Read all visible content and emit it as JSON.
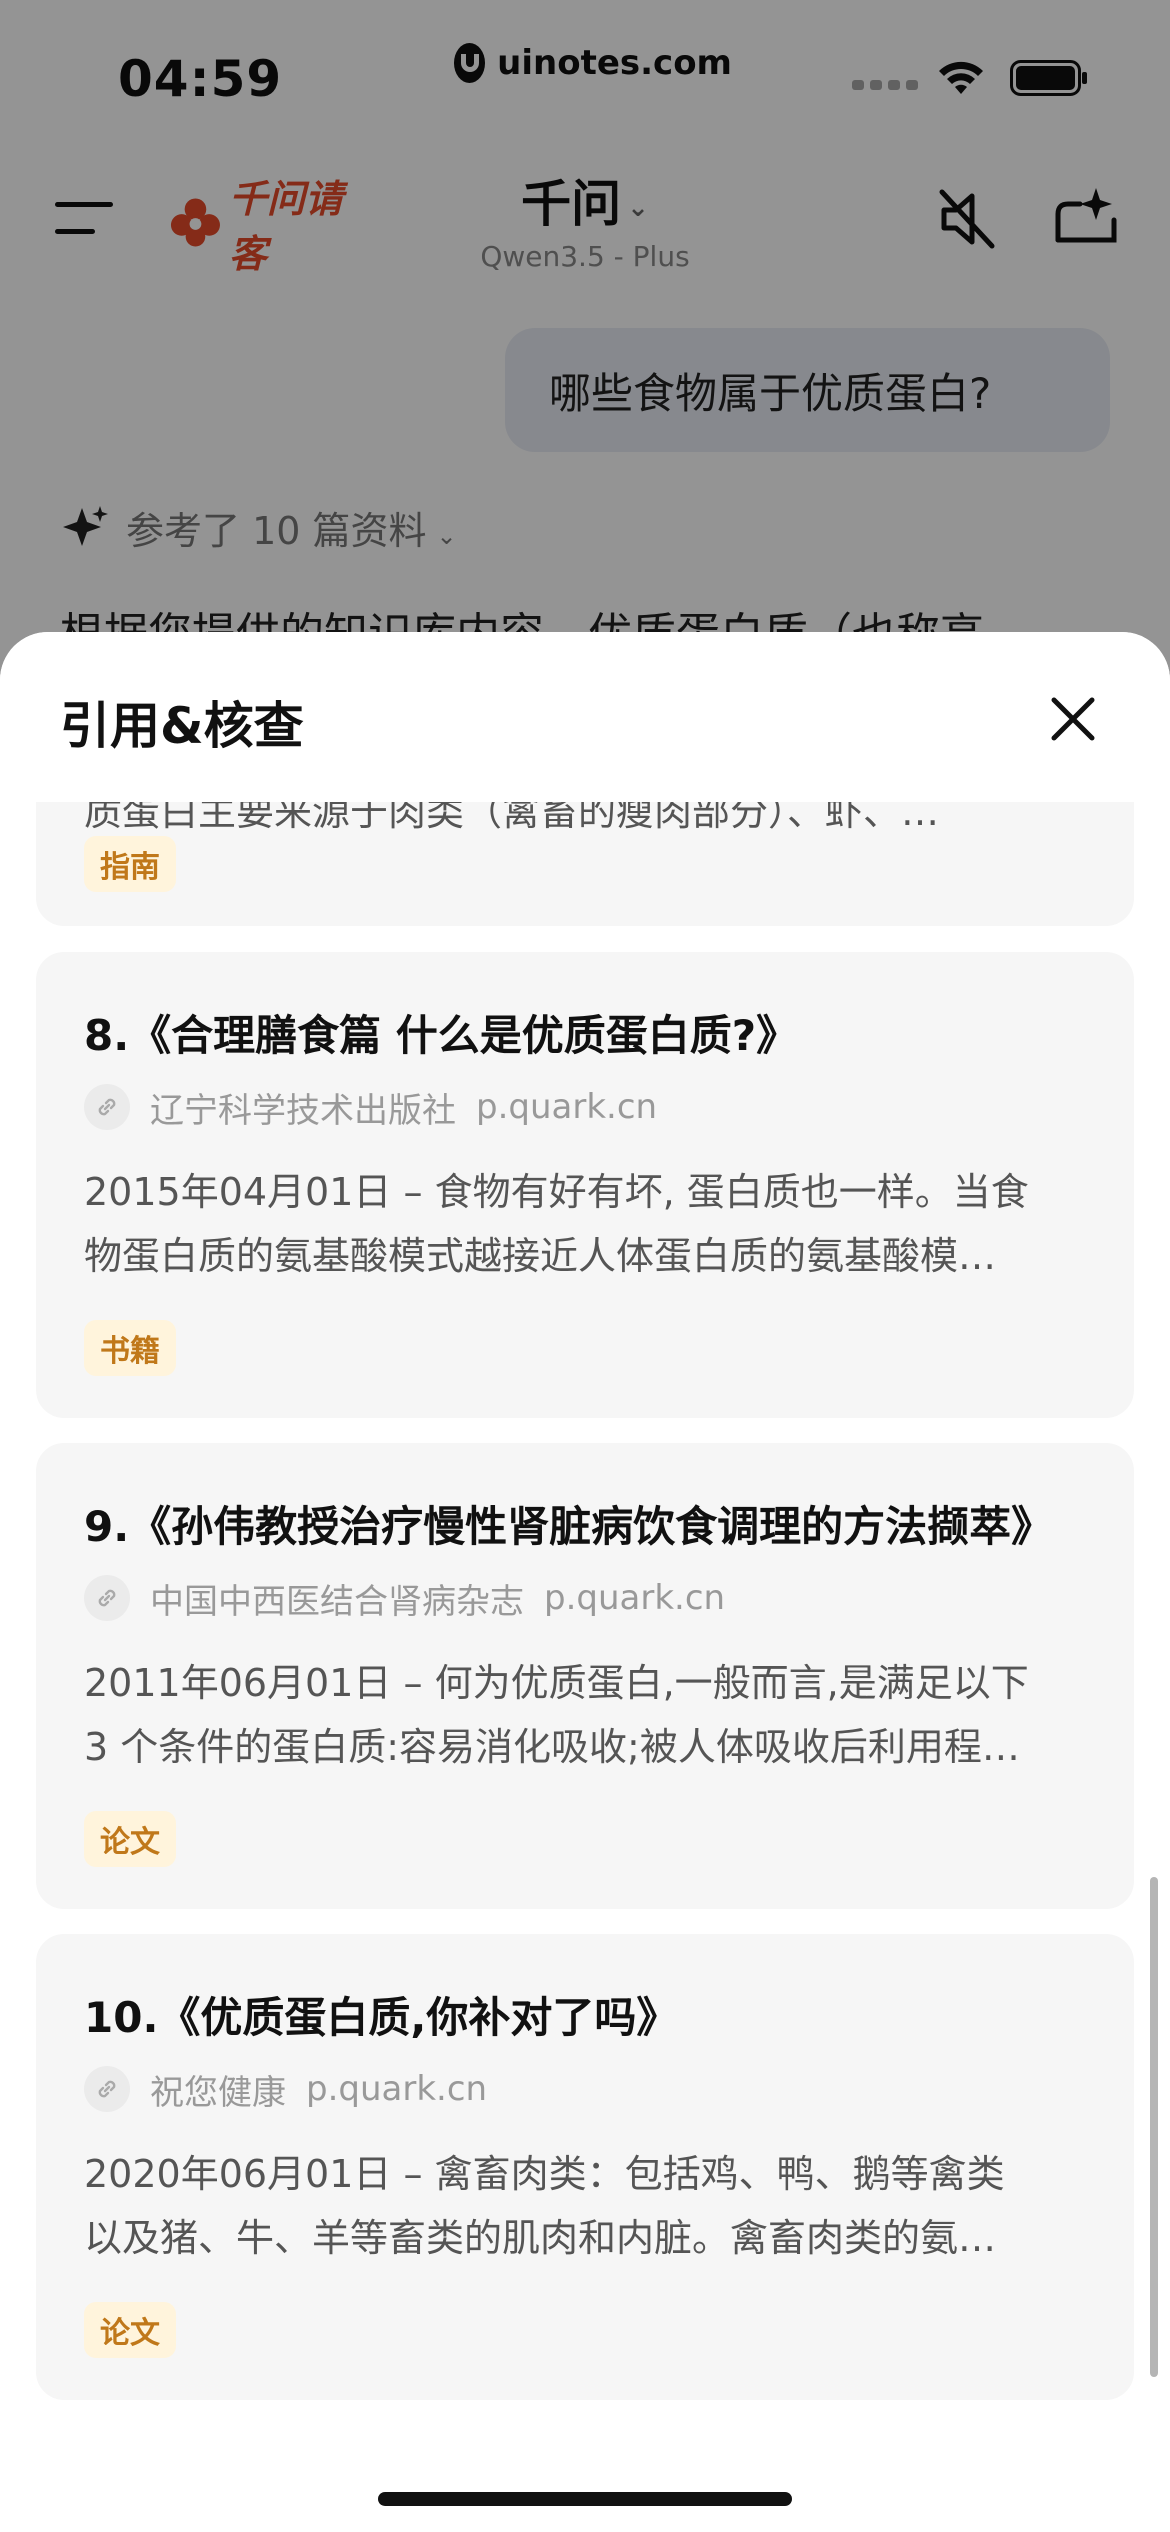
{
  "status_bar": {
    "time": "04:59",
    "watermark": "uinotes.com"
  },
  "nav": {
    "brand": "千问请客",
    "title": "千问",
    "model": "Qwen3.5 - Plus"
  },
  "chat": {
    "user_message": "哪些食物属于优质蛋白?",
    "refs_label": "参考了 10 篇资料",
    "answer_preview": "根据您提供的知识库内容，优质蛋白质（也称高"
  },
  "sheet": {
    "title": "引用&核查",
    "cards": [
      {
        "title": "",
        "source": "",
        "domain": "",
        "snippet_line1": "质蛋白主要来源于肉类（禽畜的瘦肉部分）、虾、…",
        "snippet_line2": "",
        "tag": "指南"
      },
      {
        "title": "8.《合理膳食篇 什么是优质蛋白质?》",
        "source": "辽宁科学技术出版社",
        "domain": "p.quark.cn",
        "snippet_line1": "2015年04月01日 – 食物有好有坏, 蛋白质也一样。当食",
        "snippet_line2": "物蛋白质的氨基酸模式越接近人体蛋白质的氨基酸模…",
        "tag": "书籍"
      },
      {
        "title": "9.《孙伟教授治疗慢性肾脏病饮食调理的方法撷萃》",
        "source": "中国中西医结合肾病杂志",
        "domain": "p.quark.cn",
        "snippet_line1": "2011年06月01日 – 何为优质蛋白,一般而言,是满足以下",
        "snippet_line2": "3 个条件的蛋白质:容易消化吸收;被人体吸收后利用程…",
        "tag": "论文"
      },
      {
        "title": "10.《优质蛋白质,你补对了吗》",
        "source": "祝您健康",
        "domain": "p.quark.cn",
        "snippet_line1": "2020年06月01日 – 禽畜肉类：包括鸡、鸭、鹅等禽类",
        "snippet_line2": "以及猪、牛、羊等畜类的肌肉和内脏。禽畜肉类的氨…",
        "tag": "论文"
      }
    ]
  },
  "colors": {
    "brand": "#e54a2a",
    "tag_bg": "#fff4dc",
    "tag_text": "#c0781a",
    "card_bg": "#f6f6f6"
  },
  "icons": [
    "menu-icon",
    "mute-icon",
    "new-chat-icon",
    "sparkle-icon",
    "close-icon",
    "link-icon",
    "wifi-icon",
    "battery-icon"
  ]
}
